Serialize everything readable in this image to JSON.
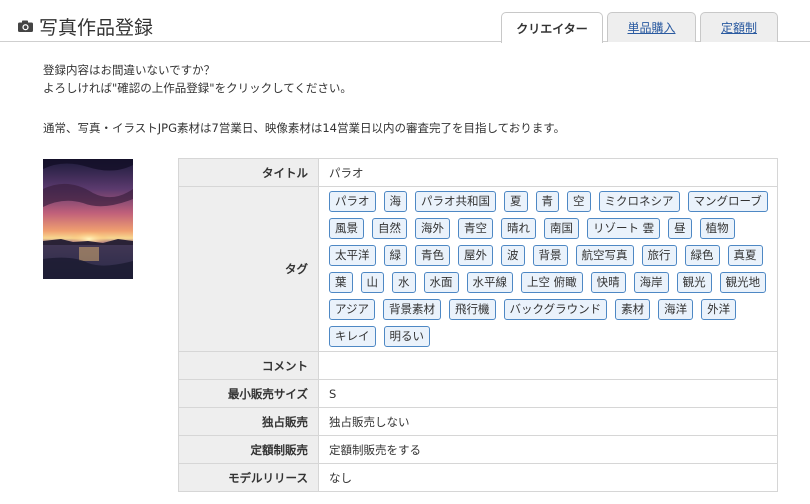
{
  "header": {
    "title": "写真作品登録",
    "icon": "camera-icon"
  },
  "tabs": [
    {
      "label": "クリエイター",
      "active": true
    },
    {
      "label": "単品購入",
      "active": false
    },
    {
      "label": "定額制",
      "active": false
    }
  ],
  "notice": {
    "line1": "登録内容はお間違いないですか？",
    "line2": "よろしければ\"確認の上作品登録\"をクリックしてください。",
    "line3": "通常、写真・イラストJPG素材は7営業日、映像素材は14営業日以内の審査完了を目指しております。"
  },
  "details": {
    "title_label": "タイトル",
    "title_value": "パラオ",
    "tags_label": "タグ",
    "tags": [
      "パラオ",
      "海",
      "パラオ共和国",
      "夏",
      "青",
      "空",
      "ミクロネシア",
      "マングローブ",
      "風景",
      "自然",
      "海外",
      "青空",
      "晴れ",
      "南国",
      "リゾート 雲",
      "昼",
      "植物",
      "太平洋",
      "緑",
      "青色",
      "屋外",
      "波",
      "背景",
      "航空写真",
      "旅行",
      "緑色",
      "真夏",
      "葉",
      "山",
      "水",
      "水面",
      "水平線",
      "上空 俯瞰",
      "快晴",
      "海岸",
      "観光",
      "観光地",
      "アジア",
      "背景素材",
      "飛行機",
      "バックグラウンド",
      "素材",
      "海洋",
      "外洋",
      "キレイ",
      "明るい"
    ],
    "comment_label": "コメント",
    "comment_value": "",
    "size_label": "最小販売サイズ",
    "size_value": "S",
    "exclusive_label": "独占販売",
    "exclusive_value": "独占販売しない",
    "flat_label": "定額制販売",
    "flat_value": "定額制販売をする",
    "release_label": "モデルリリース",
    "release_value": "なし"
  },
  "colors": {
    "tag_border": "#4e88c4",
    "tag_bg": "#eaf2fb",
    "tab_link": "#2a5aa0",
    "label_bg": "#eeeeee"
  }
}
